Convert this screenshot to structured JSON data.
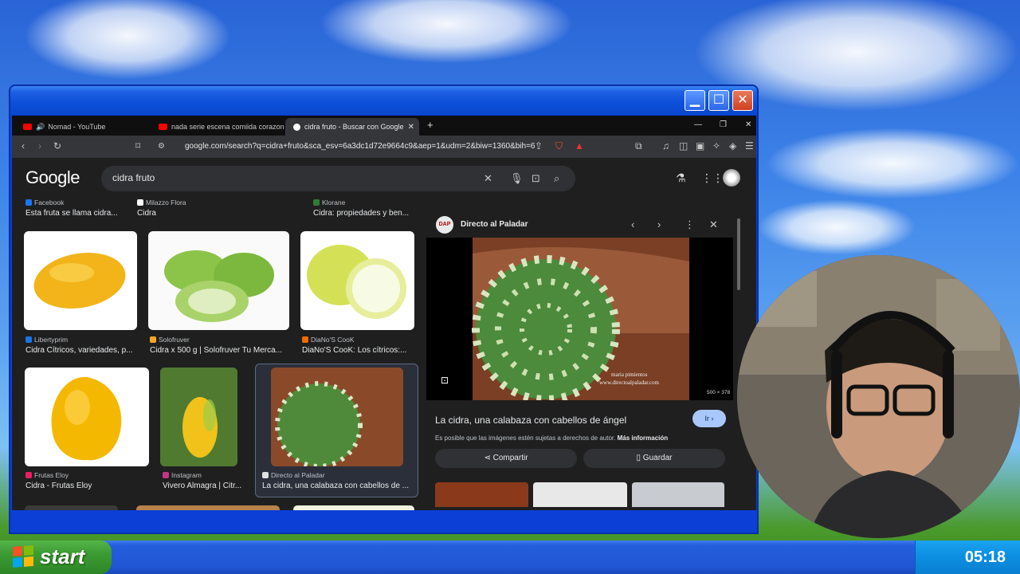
{
  "browser": {
    "tabs": [
      {
        "label": "Nomad - YouTube",
        "favicon_color": "#ff0000"
      },
      {
        "label": "nada serie escena comiida corazon -",
        "favicon_color": "#ff0000"
      },
      {
        "label": "cidra fruto - Buscar con Google",
        "favicon_color": "#4285f4"
      }
    ],
    "new_tab": "+",
    "url": "google.com/search?q=cidra+fruto&sca_esv=6a3dc1d72e9664c9&aep=1&udm=2&biw=1360&bih=6..."
  },
  "google": {
    "logo": "Google",
    "query": "cidra fruto"
  },
  "results": {
    "top_row": [
      {
        "source": "Facebook",
        "caption": "Esta fruta se llama cidra..."
      },
      {
        "source": "Milazzo Flora",
        "caption": "Cidra"
      },
      {
        "source": "Klorane",
        "caption": "Cidra: propiedades y ben..."
      }
    ],
    "row2": [
      {
        "source": "Libertyprim",
        "caption": "Cidra Cítricos, variedades, p..."
      },
      {
        "source": "Solofruver",
        "caption": "Cidra x 500 g | Solofruver Tu Merca..."
      },
      {
        "source": "DiaNo'S CooK",
        "caption": "DiaNo'S CooK: Los cítricos:..."
      }
    ],
    "row3": [
      {
        "source": "Frutas Eloy",
        "caption": "Cidra - Frutas Eloy"
      },
      {
        "source": "Instagram",
        "caption": "Vivero Almagra | Citr..."
      },
      {
        "source": "Directo al Paladar",
        "caption": "La cidra, una calabaza con cabellos de ..."
      }
    ]
  },
  "panel": {
    "source": "Directo al Paladar",
    "logo_text": "DAP",
    "dimensions": "500 × 378",
    "watermark_1": "maria pimientos",
    "watermark_2": "www.directoalpaladar.com",
    "title": "La cidra, una calabaza con cabellos de ángel",
    "go_label": "Ir",
    "copyright_note": "Es posible que las imágenes estén sujetas a derechos de autor.",
    "more_info": "Más información",
    "share_label": "Compartir",
    "save_label": "Guardar"
  },
  "taskbar": {
    "start_label": "start",
    "clock": "05:18"
  }
}
